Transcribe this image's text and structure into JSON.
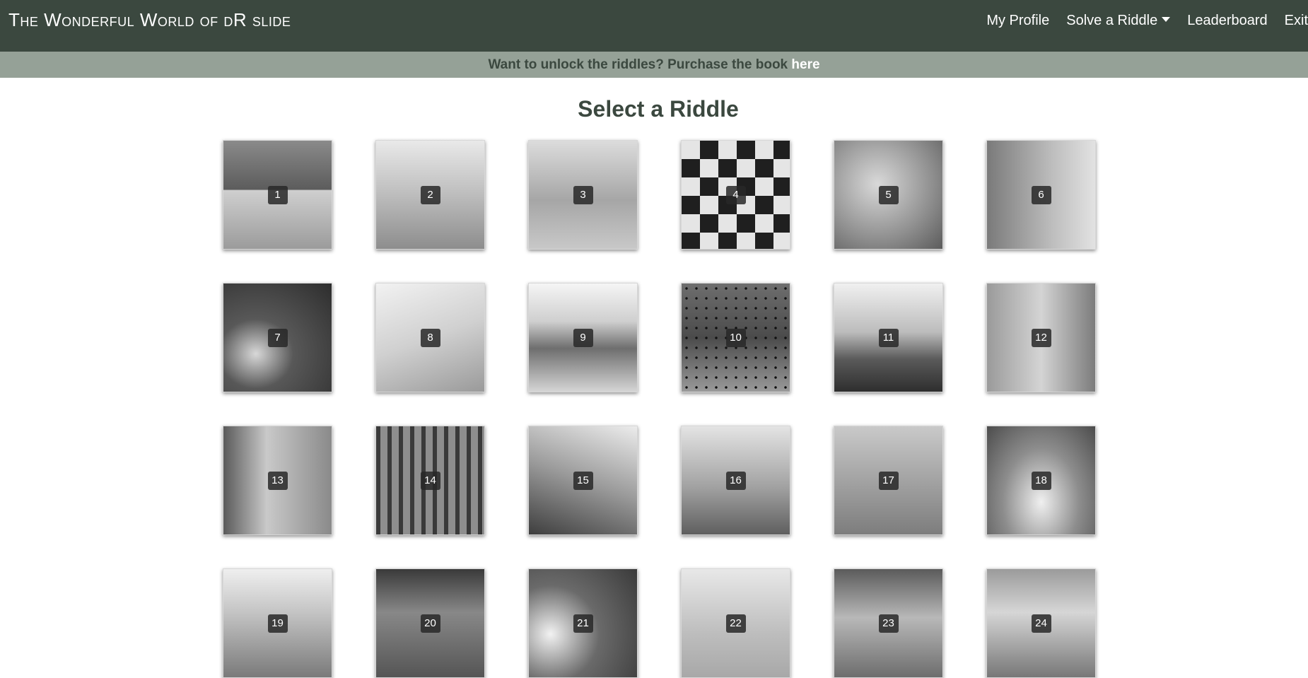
{
  "navbar": {
    "brand": "The Wonderful World of dR slide",
    "links": {
      "profile": "My Profile",
      "solve": "Solve a Riddle",
      "leaderboard": "Leaderboard",
      "exit": "Exit"
    }
  },
  "promo": {
    "text": "Want to unlock the riddles? Purchase the book ",
    "link": "here"
  },
  "page": {
    "title": "Select a Riddle"
  },
  "riddles": [
    "1",
    "2",
    "3",
    "4",
    "5",
    "6",
    "7",
    "8",
    "9",
    "10",
    "11",
    "12",
    "13",
    "14",
    "15",
    "16",
    "17",
    "18",
    "19",
    "20",
    "21",
    "22",
    "23",
    "24"
  ],
  "colors": {
    "navbar": "#3b483f",
    "promo_bar": "#95a197",
    "title": "#3b483f"
  }
}
